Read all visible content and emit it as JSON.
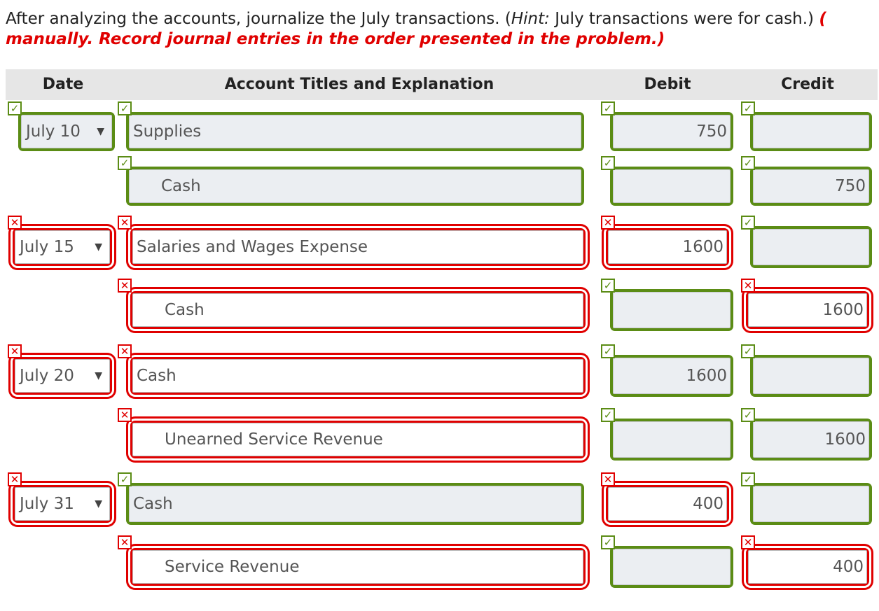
{
  "instructions": {
    "line1_before_hint": "After analyzing the accounts, journalize the July transactions. (",
    "hint_label": "Hint:",
    "line1_after_hint": " July transactions were for cash.) ",
    "line1_red_tail": "(",
    "line2_red": "manually. Record journal entries in the order presented in the problem.)"
  },
  "table": {
    "headers": {
      "date": "Date",
      "account": "Account Titles and Explanation",
      "debit": "Debit",
      "credit": "Credit"
    }
  },
  "status_colors": {
    "correct": "#5b8c15",
    "incorrect": "#e00000"
  },
  "status_icons": {
    "correct": "check-icon",
    "incorrect": "x-icon"
  },
  "rows": [
    {
      "date": "July 10",
      "date_status": "correct",
      "account": "Supplies",
      "indent": false,
      "account_status": "correct",
      "debit": "750",
      "debit_status": "correct",
      "credit": "",
      "credit_status": "correct"
    },
    {
      "date": null,
      "date_status": null,
      "account": "Cash",
      "indent": true,
      "account_status": "correct",
      "debit": "",
      "debit_status": "correct",
      "credit": "750",
      "credit_status": "correct"
    },
    {
      "date": "July 15",
      "date_status": "incorrect",
      "account": "Salaries and Wages Expense",
      "indent": false,
      "account_status": "incorrect",
      "debit": "1600",
      "debit_status": "incorrect",
      "credit": "",
      "credit_status": "correct"
    },
    {
      "date": null,
      "date_status": null,
      "account": "Cash",
      "indent": true,
      "account_status": "incorrect",
      "debit": "",
      "debit_status": "correct",
      "credit": "1600",
      "credit_status": "incorrect"
    },
    {
      "date": "July 20",
      "date_status": "incorrect",
      "account": "Cash",
      "indent": false,
      "account_status": "incorrect",
      "debit": "1600",
      "debit_status": "correct",
      "credit": "",
      "credit_status": "correct"
    },
    {
      "date": null,
      "date_status": null,
      "account": "Unearned Service Revenue",
      "indent": true,
      "account_status": "incorrect",
      "debit": "",
      "debit_status": "correct",
      "credit": "1600",
      "credit_status": "correct"
    },
    {
      "date": "July 31",
      "date_status": "incorrect",
      "account": "Cash",
      "indent": false,
      "account_status": "correct",
      "debit": "400",
      "debit_status": "incorrect",
      "credit": "",
      "credit_status": "correct"
    },
    {
      "date": null,
      "date_status": null,
      "account": "Service Revenue",
      "indent": true,
      "account_status": "incorrect",
      "debit": "",
      "debit_status": "correct",
      "credit": "400",
      "credit_status": "incorrect"
    }
  ]
}
